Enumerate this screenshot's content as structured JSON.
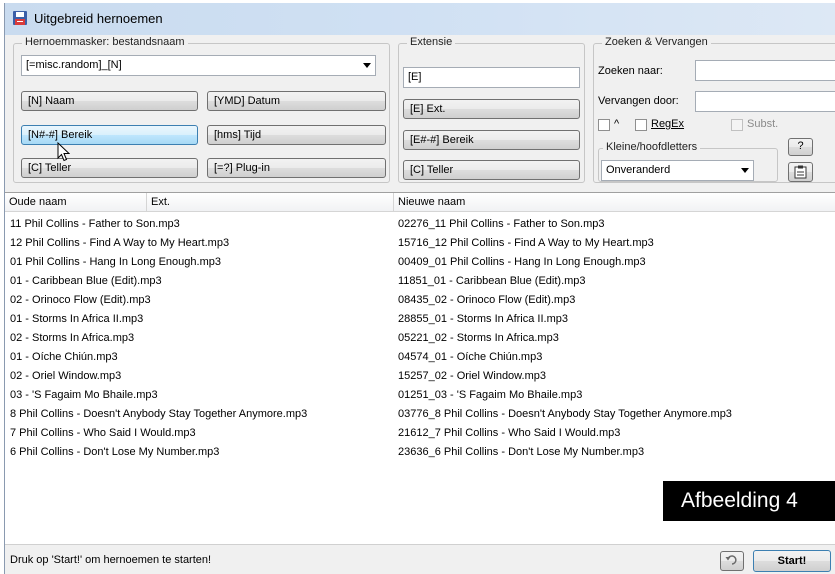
{
  "window": {
    "title": "Uitgebreid hernoemen"
  },
  "mask": {
    "legend": "Hernoemmasker: bestandsnaam",
    "value": "[=misc.random]_[N]",
    "buttons": {
      "name": "[N] Naam",
      "date": "[YMD] Datum",
      "range": "[N#-#] Bereik",
      "time": "[hms] Tijd",
      "counter": "[C] Teller",
      "plugin": "[=?] Plug-in"
    }
  },
  "extension": {
    "legend": "Extensie",
    "value": "[E]",
    "buttons": {
      "ext": "[E] Ext.",
      "range": "[E#-#] Bereik",
      "counter": "[C] Teller"
    }
  },
  "search": {
    "legend": "Zoeken & Vervangen",
    "find_label": "Zoeken naar:",
    "find_value": "",
    "replace_label": "Vervangen door:",
    "replace_value": "",
    "caret_label": "^",
    "regex_label": "RegEx",
    "subst_label": "Subst.",
    "case_legend": "Kleine/hoofdletters",
    "case_value": "Onveranderd",
    "help_label": "?"
  },
  "list": {
    "headers": {
      "old_name": "Oude naam",
      "ext": "Ext.",
      "new_name": "Nieuwe naam"
    },
    "old_names": [
      "11 Phil Collins - Father to Son.mp3",
      "12 Phil Collins - Find A Way to My Heart.mp3",
      "01 Phil Collins - Hang In Long Enough.mp3",
      "01 - Caribbean Blue (Edit).mp3",
      "02 - Orinoco Flow (Edit).mp3",
      "01 - Storms In Africa II.mp3",
      "02 - Storms In Africa.mp3",
      "01 - Oíche Chiún.mp3",
      "02 - Oriel Window.mp3",
      "03 - 'S Fagaim Mo Bhaile.mp3",
      "8 Phil Collins - Doesn't Anybody Stay Together Anymore.mp3",
      "7 Phil Collins - Who Said I Would.mp3",
      "6 Phil Collins - Don't Lose My Number.mp3"
    ],
    "new_names": [
      "02276_11 Phil Collins - Father to Son.mp3",
      "15716_12 Phil Collins - Find A Way to My Heart.mp3",
      "00409_01 Phil Collins - Hang In Long Enough.mp3",
      "11851_01 - Caribbean Blue (Edit).mp3",
      "08435_02 - Orinoco Flow (Edit).mp3",
      "28855_01 - Storms In Africa II.mp3",
      "05221_02 - Storms In Africa.mp3",
      "04574_01 - Oíche Chiún.mp3",
      "15257_02 - Oriel Window.mp3",
      "01251_03 - 'S Fagaim Mo Bhaile.mp3",
      "03776_8 Phil Collins - Doesn't Anybody Stay Together Anymore.mp3",
      "21612_7 Phil Collins - Who Said I Would.mp3",
      "23636_6 Phil Collins - Don't Lose My Number.mp3"
    ]
  },
  "status": {
    "text": "Druk op 'Start!' om hernoemen te starten!",
    "start_label": "Start!"
  },
  "caption": "Afbeelding 4",
  "icons": {
    "title": "floppy-disk-icon",
    "cursor": "mouse-pointer-icon",
    "copy": "clipboard-icon",
    "undo": "undo-icon"
  },
  "colors": {
    "titlebar": "#cfe0f3",
    "button_hover": "#bee6fd",
    "caption_bg": "#000000"
  }
}
